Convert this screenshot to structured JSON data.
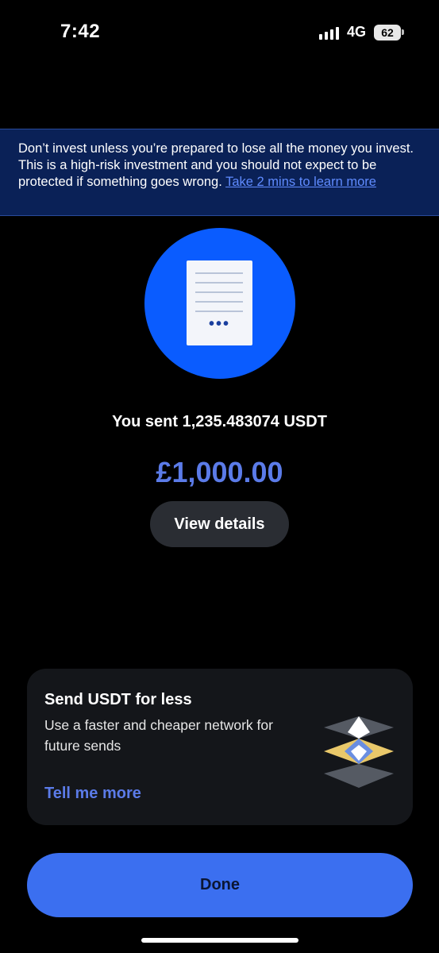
{
  "status_bar": {
    "time": "7:42",
    "network": "4G",
    "battery": "62",
    "signal_icon": "signal-bars-icon",
    "battery_icon": "battery-icon"
  },
  "risk_banner": {
    "text": "Don’t invest unless you’re prepared to lose all the money you invest. This is a high-risk investment and you should not expect to be protected if something goes wrong. ",
    "link": "Take 2 mins to learn more"
  },
  "transaction": {
    "illustration_icon": "receipt-icon",
    "sent_text": "You sent 1,235.483074 USDT",
    "amount": "£1,000.00",
    "view_details_label": "View details"
  },
  "promo": {
    "title": "Send USDT for less",
    "body": "Use a faster and cheaper network for future sends",
    "link": "Tell me more",
    "icon": "network-layers-icon"
  },
  "done_label": "Done",
  "colors": {
    "accent": "#3b6ff0",
    "amount": "#5b7be8",
    "banner_bg": "#0a2157",
    "circle": "#0a5cff",
    "promo_icon_gold": "#e9c86a"
  }
}
